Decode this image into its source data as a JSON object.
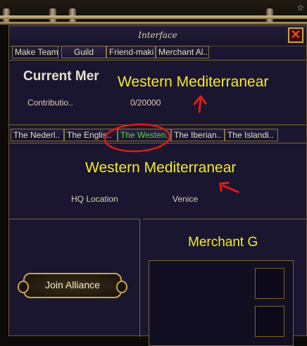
{
  "top_glyph": "☆",
  "window": {
    "title": "Interface",
    "close_icon": "✕"
  },
  "tabs": [
    {
      "label": "Make Team"
    },
    {
      "label": "Guild"
    },
    {
      "label": "Friend-maki"
    },
    {
      "label": "Merchant Al.."
    }
  ],
  "header": {
    "current_label": "Current Mer",
    "alliance_name": "Western Mediterranear",
    "contribution_label": "Contributio..",
    "contribution_value": "0/20000"
  },
  "region_tabs": [
    {
      "label": "The Nederl.."
    },
    {
      "label": "The Englis.."
    },
    {
      "label": "The Westen.."
    },
    {
      "label": "The Iberian.."
    },
    {
      "label": "The Islandi.."
    }
  ],
  "region": {
    "name": "Western Mediterranear",
    "hq_label": "HQ Location",
    "hq_value": "Venice"
  },
  "actions": {
    "join_label": "Join Alliance"
  },
  "right_panel": {
    "title": "Merchant G"
  },
  "colors": {
    "highlight_text": "#f5ea2a",
    "selected_tab_text": "#5ad34a",
    "annotation": "#e31b12",
    "gold_border": "#c9a64a"
  }
}
